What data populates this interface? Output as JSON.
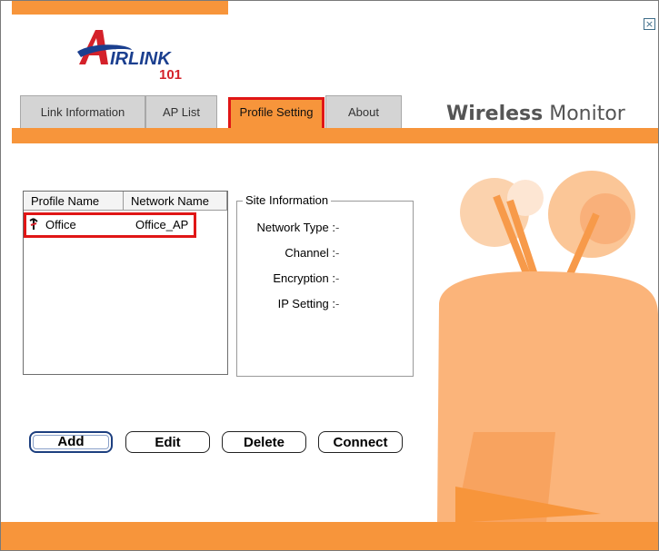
{
  "logo": {
    "text": "IRLINK",
    "number": "101"
  },
  "tabs": [
    {
      "label": "Link Information",
      "active": false
    },
    {
      "label": "AP List",
      "active": false
    },
    {
      "label": "Profile Setting",
      "active": true
    },
    {
      "label": "About",
      "active": false
    }
  ],
  "brand": {
    "bold": "Wireless",
    "light": " Monitor"
  },
  "profile_list": {
    "columns": [
      "Profile Name",
      "Network Name"
    ],
    "rows": [
      {
        "profile": "Office",
        "network": "Office_AP",
        "icon": "antenna-icon"
      }
    ]
  },
  "site_info": {
    "title": "Site Information",
    "fields": [
      {
        "label": "Network Type :",
        "value": "-"
      },
      {
        "label": "Channel :",
        "value": "-"
      },
      {
        "label": "Encryption :",
        "value": "-"
      },
      {
        "label": "IP Setting :",
        "value": "-"
      }
    ]
  },
  "buttons": {
    "add": "Add",
    "edit": "Edit",
    "delete": "Delete",
    "connect": "Connect"
  },
  "close_glyph": "×",
  "colors": {
    "accent": "#f7953b",
    "highlight": "#e01616",
    "brand_blue": "#1b3f8f"
  }
}
